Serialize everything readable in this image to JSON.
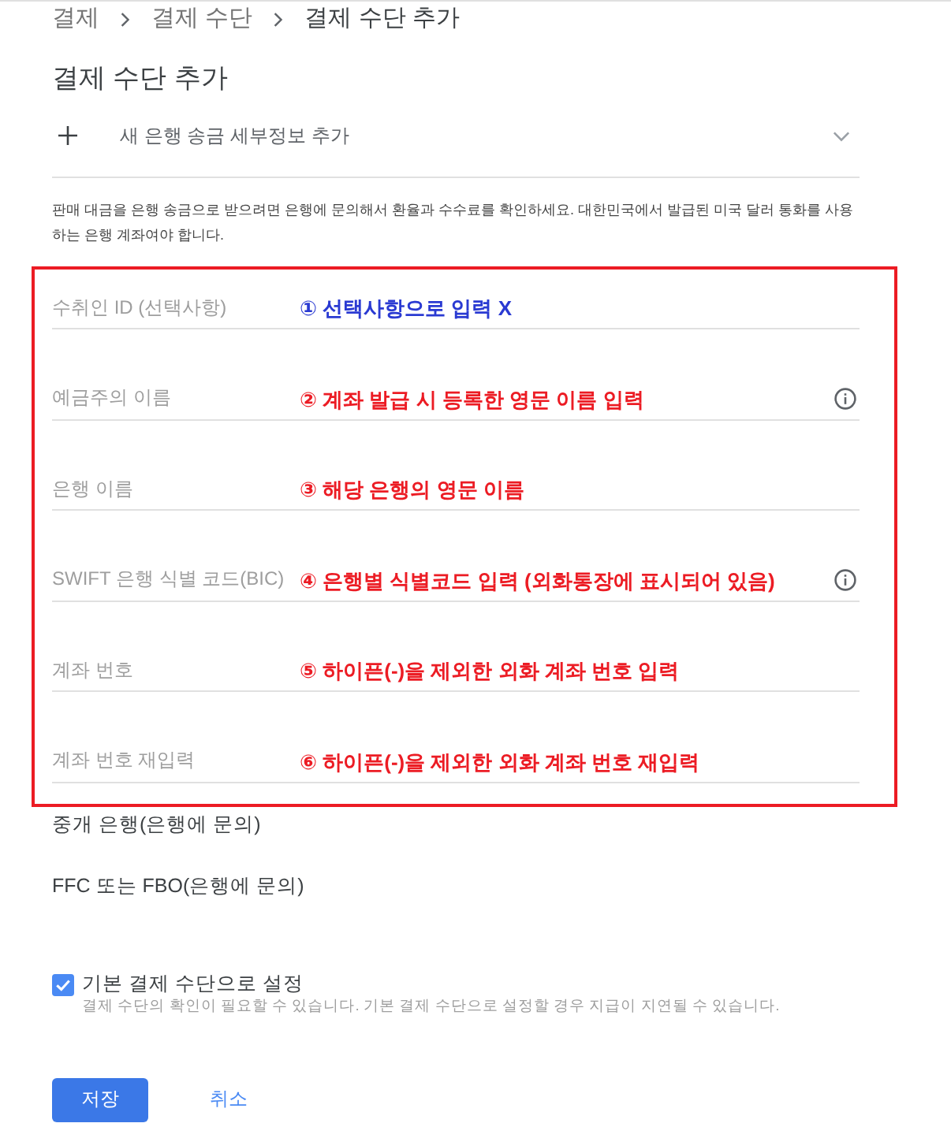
{
  "breadcrumb": [
    {
      "label": "결제",
      "current": false
    },
    {
      "label": "결제 수단",
      "current": false
    },
    {
      "label": "결제 수단 추가",
      "current": true
    }
  ],
  "title": "결제 수단 추가",
  "add_row": {
    "label": "새 은행 송금 세부정보 추가",
    "expanded": false
  },
  "notice": "판매 대금을 은행 송금으로 받으려면 은행에 문의해서 환율과 수수료를 확인하세요. 대한민국에서 발급된 미국 달러 통화를 사용하는 은행 계좌여야 합니다.",
  "fields": [
    {
      "placeholder": "수취인 ID (선택사항)",
      "info": false,
      "annotation": {
        "text": "① 선택사항으로 입력 X",
        "color": "#2a3ad2"
      }
    },
    {
      "placeholder": "예금주의 이름",
      "info": true,
      "annotation": {
        "text": "② 계좌 발급 시 등록한 영문 이름 입력",
        "color": "#ec1c24"
      }
    },
    {
      "placeholder": "은행 이름",
      "info": false,
      "annotation": {
        "text": "③ 해당 은행의 영문 이름",
        "color": "#ec1c24"
      }
    },
    {
      "placeholder": "SWIFT 은행 식별 코드(BIC)",
      "info": true,
      "annotation": {
        "text": "④ 은행별 식별코드 입력 (외화통장에 표시되어 있음)",
        "color": "#ec1c24"
      }
    },
    {
      "placeholder": "계좌 번호",
      "info": false,
      "annotation": {
        "text": "⑤ 하이픈(-)을 제외한 외화 계좌 번호 입력",
        "color": "#ec1c24"
      }
    },
    {
      "placeholder": "계좌 번호 재입력",
      "info": false,
      "annotation": {
        "text": "⑥ 하이픈(-)을 제외한 외화 계좌 번호 재입력",
        "color": "#ec1c24"
      }
    }
  ],
  "more_sections": [
    "중개 은행(은행에 문의)",
    "FFC 또는 FBO(은행에 문의)"
  ],
  "default_method": {
    "label": "기본 결제 수단으로 설정",
    "description": "결제 수단의 확인이 필요할 수 있습니다. 기본 결제 수단으로 설정할 경우 지급이 지연될 수 있습니다.",
    "checked": true
  },
  "actions": [
    {
      "label": "저장",
      "kind": "primary"
    },
    {
      "label": "취소",
      "kind": "text"
    }
  ]
}
